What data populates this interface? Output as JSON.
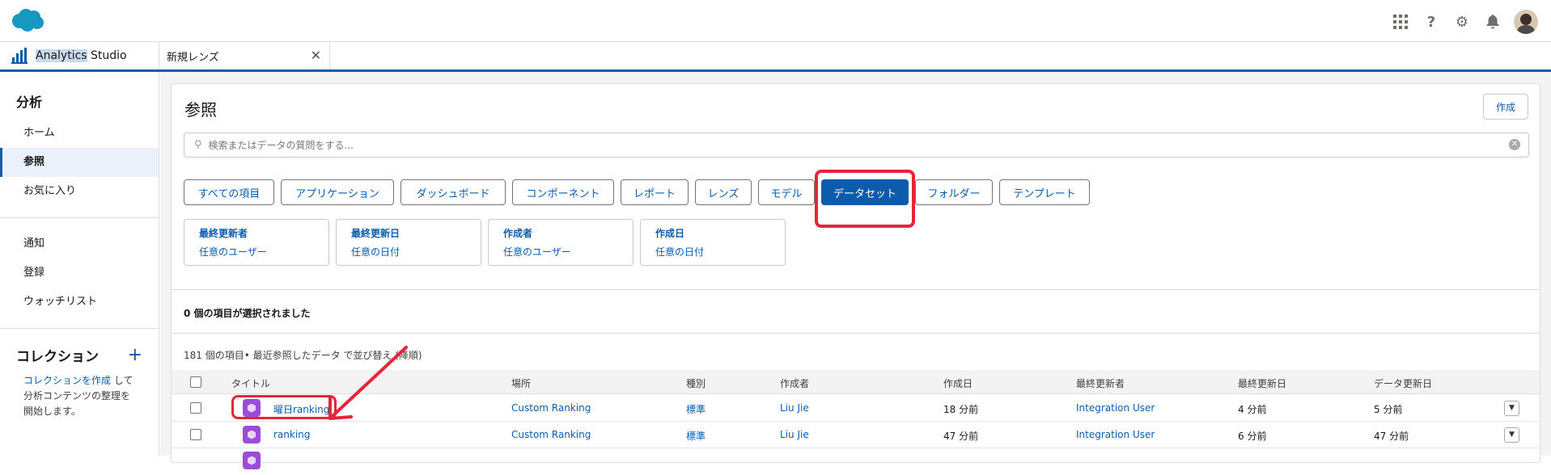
{
  "header": {
    "icons": [
      "salesforce-cloud-logo",
      "app-launcher-icon",
      "help-icon",
      "setup-gear-icon",
      "notifications-bell-icon",
      "user-avatar"
    ]
  },
  "tabs": {
    "app_name_highlight": "Analytics",
    "app_name_rest": " Studio",
    "lens_tab": "新規レンズ",
    "close": "✕"
  },
  "sidebar": {
    "heading": "分析",
    "items": [
      "ホーム",
      "参照",
      "お気に入り"
    ],
    "items2": [
      "通知",
      "登録",
      "ウォッチリスト"
    ],
    "collection_heading": "コレクション",
    "collection_plus": "+",
    "collection_link": "コレクションを作成",
    "collection_text1": " して",
    "collection_text2": "分析コンテンツの整理を",
    "collection_text3": "開始します。"
  },
  "main": {
    "title": "参照",
    "create": "作成",
    "search_placeholder": "検索またはデータの質問をする...",
    "chips": [
      "すべての項目",
      "アプリケーション",
      "ダッシュボード",
      "コンポーネント",
      "レポート",
      "レンズ",
      "モデル",
      "データセット",
      "フォルダー",
      "テンプレート"
    ],
    "filters": [
      {
        "label": "最終更新者",
        "value": "任意のユーザー"
      },
      {
        "label": "最終更新日",
        "value": "任意の日付"
      },
      {
        "label": "作成者",
        "value": "任意のユーザー"
      },
      {
        "label": "作成日",
        "value": "任意の日付"
      }
    ],
    "selected_text": "0 個の項目が選択されました",
    "count_text": "181 個の項目• 最近参照したデータ で並び替え (降順)",
    "columns": [
      "タイトル",
      "場所",
      "種別",
      "作成者",
      "作成日",
      "最終更新者",
      "最終更新日",
      "データ更新日"
    ],
    "rows": [
      {
        "title": "曜日ranking",
        "location": "Custom Ranking",
        "type": "標準",
        "creator": "Liu Jie",
        "created": "18 分前",
        "modifier": "Integration User",
        "modified": "4 分前",
        "data_updated": "5 分前"
      },
      {
        "title": "ranking",
        "location": "Custom Ranking",
        "type": "標準",
        "creator": "Liu Jie",
        "created": "47 分前",
        "modifier": "Integration User",
        "modified": "6 分前",
        "data_updated": "47 分前"
      }
    ]
  },
  "colors": {
    "brand": "#0b5cab",
    "annotation": "#e8243b",
    "dataset_icon": "#9a4dd8"
  }
}
